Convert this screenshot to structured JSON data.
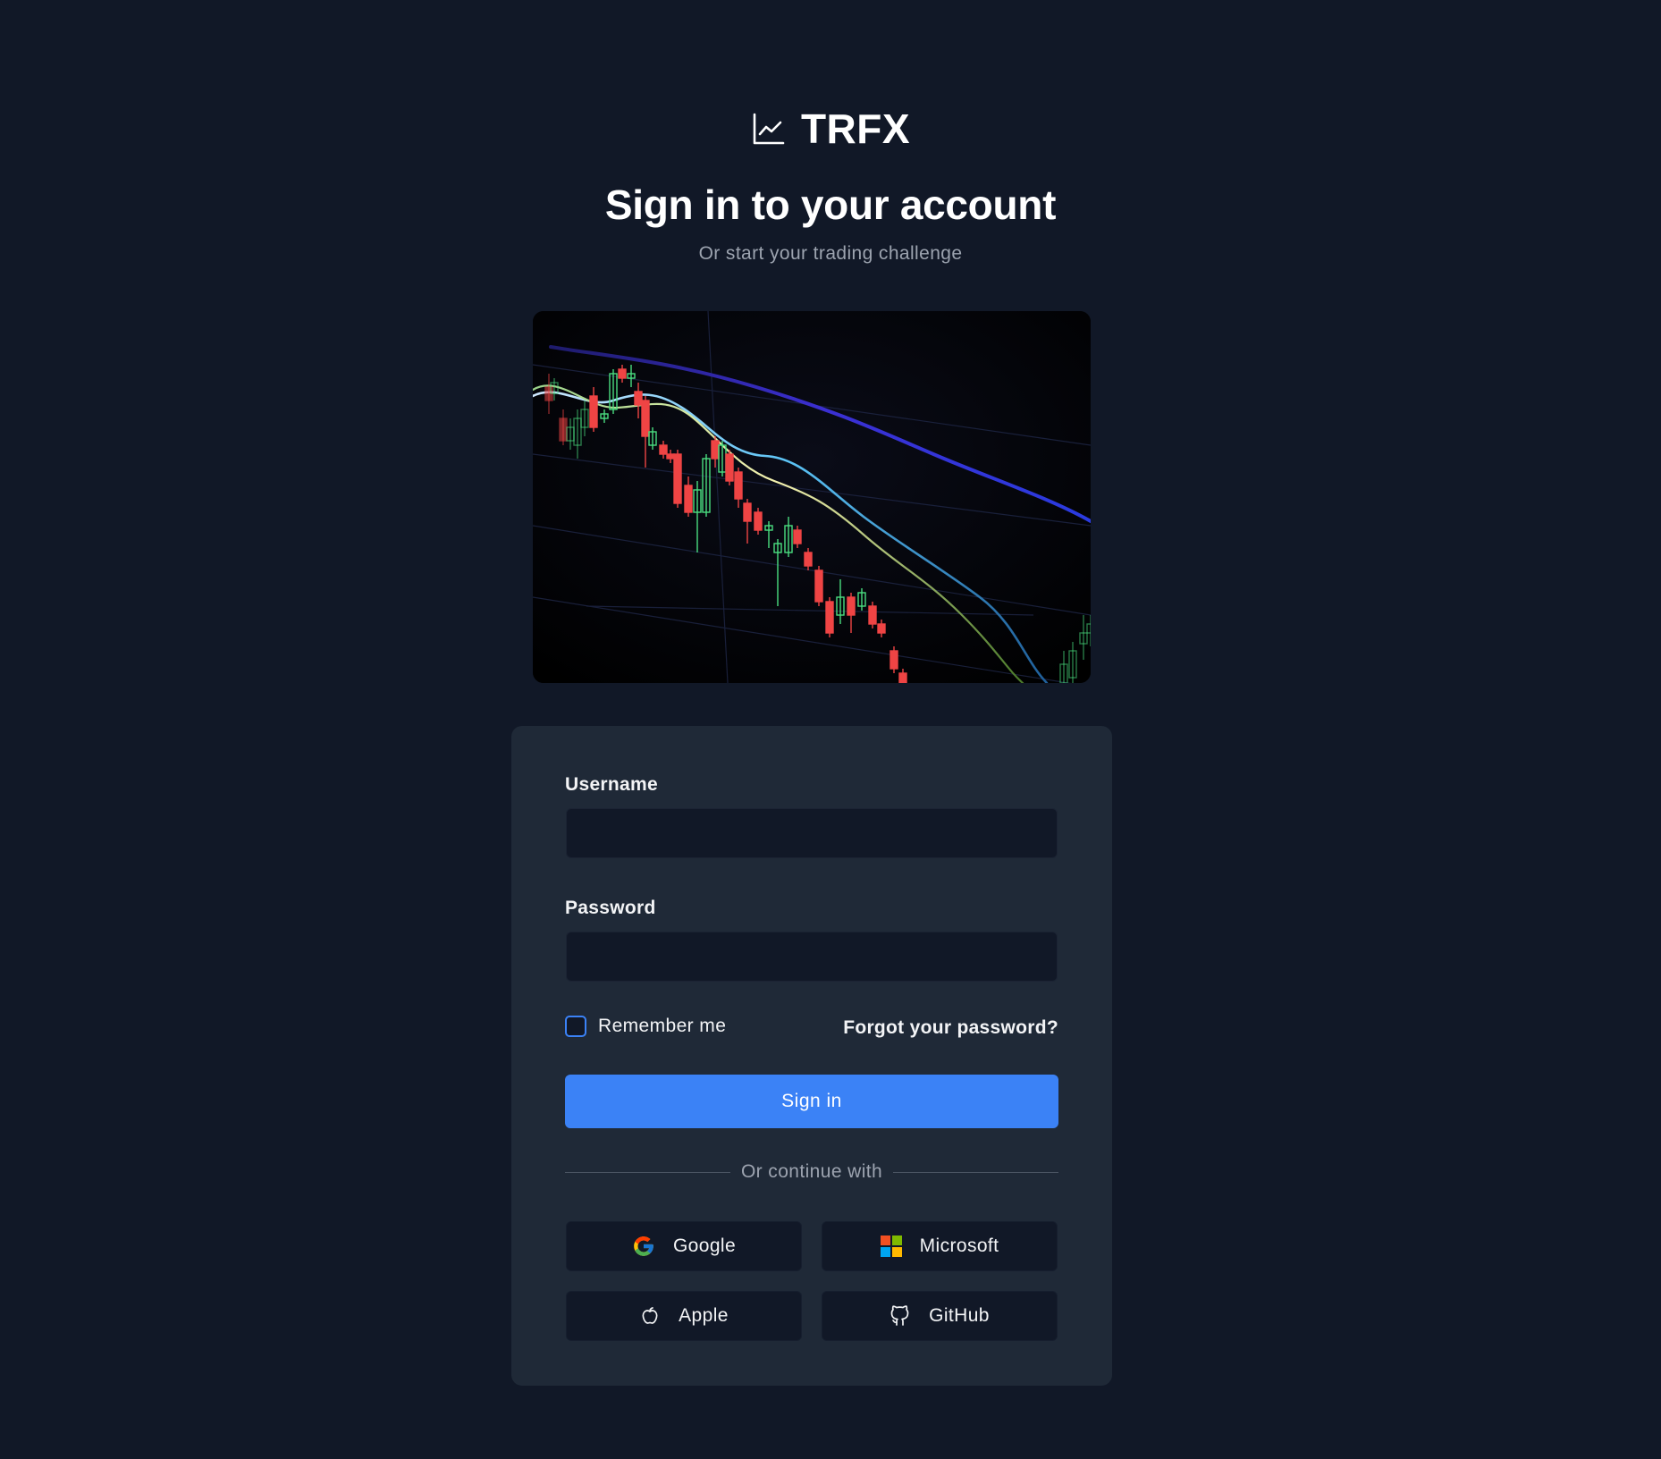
{
  "brand": {
    "name": "TRFX",
    "icon": "chart-line-icon"
  },
  "header": {
    "title": "Sign in to your account",
    "subtitle": "Or start your trading challenge"
  },
  "hero_image": {
    "content": "candlestick-chart-photo"
  },
  "form": {
    "username": {
      "label": "Username",
      "value": "",
      "placeholder": ""
    },
    "password": {
      "label": "Password",
      "value": "",
      "placeholder": ""
    },
    "remember_me": {
      "label": "Remember me",
      "checked": false
    },
    "forgot_password": "Forgot your password?",
    "submit_label": "Sign in"
  },
  "social": {
    "divider_text": "Or continue with",
    "providers": [
      {
        "label": "Google",
        "icon": "google-icon"
      },
      {
        "label": "Microsoft",
        "icon": "microsoft-icon"
      },
      {
        "label": "Apple",
        "icon": "apple-icon"
      },
      {
        "label": "GitHub",
        "icon": "github-icon"
      }
    ]
  },
  "colors": {
    "background": "#111827",
    "card": "#1f2937",
    "input": "#111827",
    "accent": "#3b82f6",
    "muted_text": "#9ca3af",
    "candle_up": "#4ade80",
    "candle_down": "#ef4444"
  }
}
